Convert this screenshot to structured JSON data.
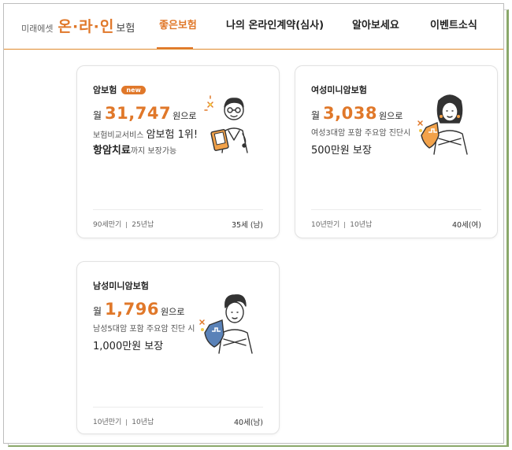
{
  "header": {
    "logo_prefix": "미래에셋",
    "logo_main": "온·라·인",
    "logo_suffix": "보험",
    "nav": [
      {
        "label": "좋은보험",
        "active": true
      },
      {
        "label": "나의 온라인계약(심사)",
        "active": false
      },
      {
        "label": "알아보세요",
        "active": false
      },
      {
        "label": "이벤트소식",
        "active": false
      }
    ]
  },
  "cards": [
    {
      "title": "암보험",
      "badge": "new",
      "price_prefix": "월",
      "price": "31,747",
      "price_suffix": "원으로",
      "desc1_small": "보험비교서비스",
      "desc1_big": "암보험 1위!",
      "desc2_bold": "항암치료",
      "desc2_small": "까지 보장가능",
      "term_left": "90세만기",
      "term_right": "25년납",
      "age": "35세 (남)",
      "illustration": "doctor-icon"
    },
    {
      "title": "여성미니암보험",
      "price_prefix": "월",
      "price": "3,038",
      "price_suffix": "원으로",
      "desc1": "여성3대암 포함 주요암 진단시",
      "desc2": "500만원 보장",
      "term_left": "10년만기",
      "term_right": "10년납",
      "age": "40세(여)",
      "illustration": "woman-shield-icon"
    },
    {
      "title": "남성미니암보험",
      "price_prefix": "월",
      "price": "1,796",
      "price_suffix": "원으로",
      "desc1": "남성5대암 포함 주요암 진단 시",
      "desc2": "1,000만원 보장",
      "term_left": "10년만기",
      "term_right": "10년납",
      "age": "40세(남)",
      "illustration": "man-shield-icon"
    }
  ],
  "colors": {
    "accent": "#e0782a",
    "border": "#e2e2e2",
    "shield": "#5a82b8"
  }
}
